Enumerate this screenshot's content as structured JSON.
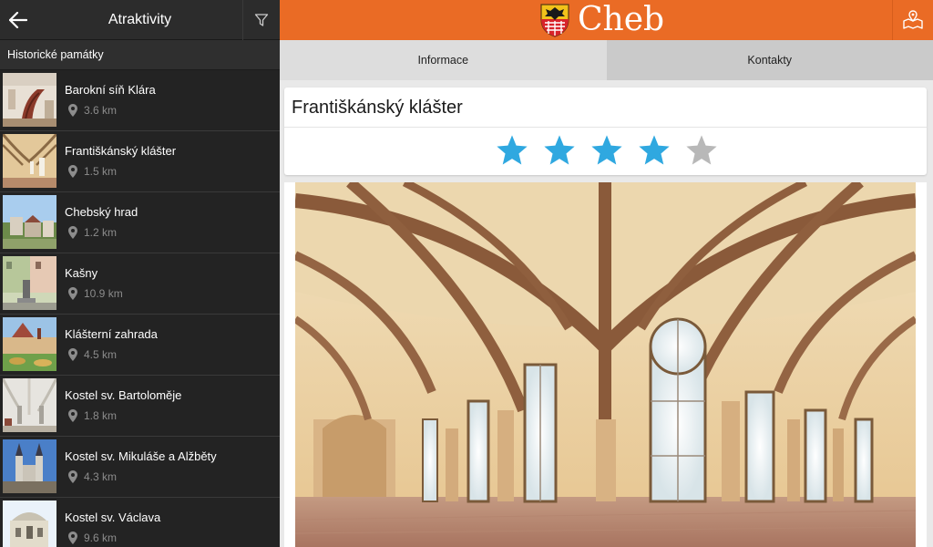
{
  "sidebar": {
    "title": "Atraktivity",
    "category": "Historické památky",
    "items": [
      {
        "name": "Barokní síň Klára",
        "distance": "3.6 km",
        "thumb": "stair-hall"
      },
      {
        "name": "Františkánský klášter",
        "distance": "1.5 km",
        "thumb": "cloister"
      },
      {
        "name": "Chebský hrad",
        "distance": "1.2 km",
        "thumb": "castle"
      },
      {
        "name": "Kašny",
        "distance": "10.9 km",
        "thumb": "fountain"
      },
      {
        "name": "Klášterní zahrada",
        "distance": "4.5 km",
        "thumb": "garden"
      },
      {
        "name": "Kostel sv. Bartoloměje",
        "distance": "1.8 km",
        "thumb": "church-interior"
      },
      {
        "name": "Kostel sv. Mikuláše a Alžběty",
        "distance": "4.3 km",
        "thumb": "twin-towers"
      },
      {
        "name": "Kostel sv. Václava",
        "distance": "9.6 km",
        "thumb": "baroque-facade"
      }
    ]
  },
  "header": {
    "logo_text": "Cheb",
    "accent_color": "#ea6b25"
  },
  "tabs": [
    {
      "label": "Informace",
      "active": true
    },
    {
      "label": "Kontakty",
      "active": false
    }
  ],
  "detail": {
    "title": "Františkánský klášter",
    "rating": 4,
    "rating_max": 5,
    "star_color": "#2fa8e0",
    "star_empty_color": "#b8b8b8",
    "image": "cloister-vaulted-corridor"
  },
  "icons": {
    "back": "arrow-left-icon",
    "filter": "funnel-icon",
    "map": "map-pin-icon",
    "distance": "location-pin-icon",
    "star": "star-icon",
    "coat_of_arms": "coat-of-arms-icon"
  }
}
